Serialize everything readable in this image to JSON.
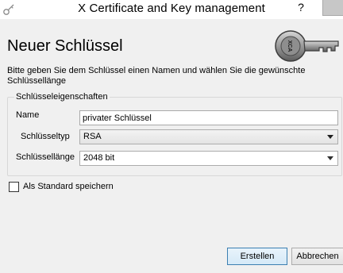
{
  "window": {
    "title": "X Certificate and Key management",
    "help_label": "?"
  },
  "page": {
    "title": "Neuer Schlüssel",
    "description": "Bitte geben Sie dem Schlüssel einen Namen und wählen Sie die gewünschte Schlüssellänge"
  },
  "key_properties": {
    "group_title": "Schlüsseleigenschaften",
    "name_label": "Name",
    "name_value": "privater Schlüssel",
    "type_label": "Schlüsseltyp",
    "type_value": "RSA",
    "size_label": "Schlüssellänge",
    "size_value": "2048 bit"
  },
  "options": {
    "default_label": "Als Standard speichern",
    "default_checked": false
  },
  "buttons": {
    "create_label": "Erstellen",
    "cancel_label": "Abbrechen"
  },
  "key_image": {
    "icon": "key-icon",
    "engraving": "XCA"
  },
  "colors": {
    "dialog_background": "#f0f0f0",
    "primary_button_border": "#3c7fb1",
    "close_button": "#c7c7c7"
  }
}
